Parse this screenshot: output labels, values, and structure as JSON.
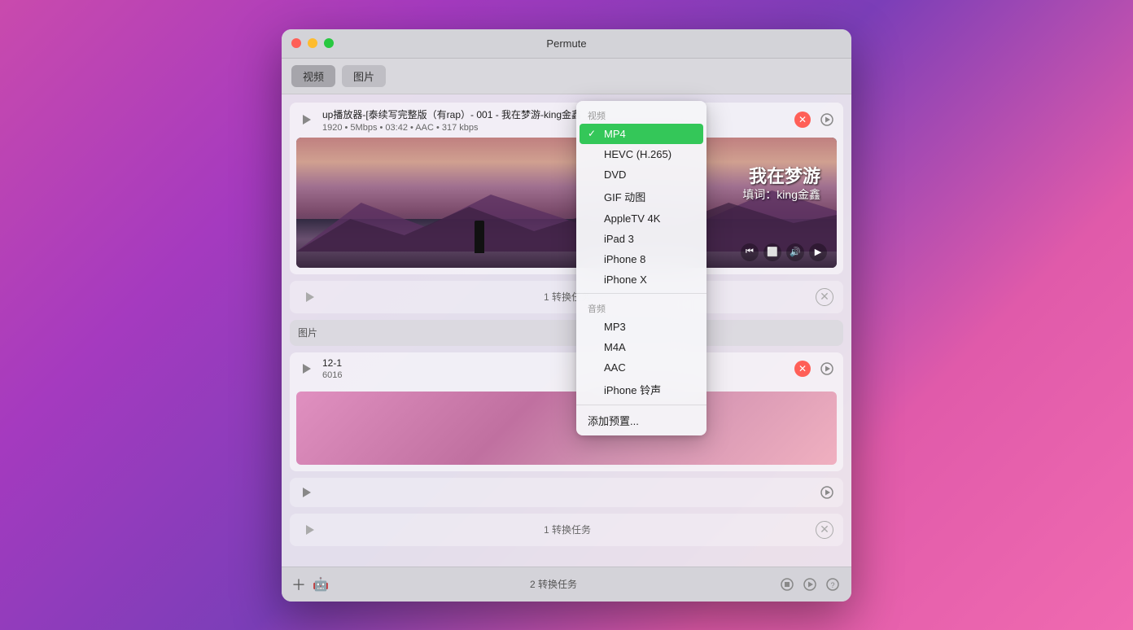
{
  "window": {
    "title": "Permute",
    "buttons": {
      "close": "●",
      "minimize": "●",
      "maximize": "●"
    }
  },
  "toolbar": {
    "video_label": "视频",
    "image_label": "图片",
    "active_tab": "视频"
  },
  "dropdown": {
    "video_section_label": "视频",
    "items_video": [
      {
        "label": "MP4",
        "selected": true
      },
      {
        "label": "HEVC (H.265)",
        "selected": false
      },
      {
        "label": "DVD",
        "selected": false
      },
      {
        "label": "GIF 动图",
        "selected": false
      },
      {
        "label": "AppleTV 4K",
        "selected": false
      },
      {
        "label": "iPad 3",
        "selected": false
      },
      {
        "label": "iPhone 8",
        "selected": false
      },
      {
        "label": "iPhone X",
        "selected": false
      }
    ],
    "audio_section_label": "音频",
    "items_audio": [
      {
        "label": "MP3",
        "selected": false
      },
      {
        "label": "M4A",
        "selected": false
      },
      {
        "label": "AAC",
        "selected": false
      },
      {
        "label": "iPhone 铃声",
        "selected": false
      }
    ],
    "add_preset_label": "添加预置..."
  },
  "rows": {
    "row1": {
      "filename": "up播放器-[泰续写完整版（有rap）- 001 - 我在梦游-king金鑫",
      "meta": "1920 • 5Mbps • 03:42 • AAC • 317 kbps",
      "subtitle_main": "我在梦游",
      "subtitle_sub": "填词：king金鑫"
    },
    "row2": {
      "task_text": "1 转换任务"
    },
    "row3_label": "图片",
    "row4": {
      "filename": "12-1",
      "meta": "6016"
    },
    "row5": {
      "task_text": "1 转换任务"
    }
  },
  "bottombar": {
    "task_count": "2 转换任务"
  }
}
